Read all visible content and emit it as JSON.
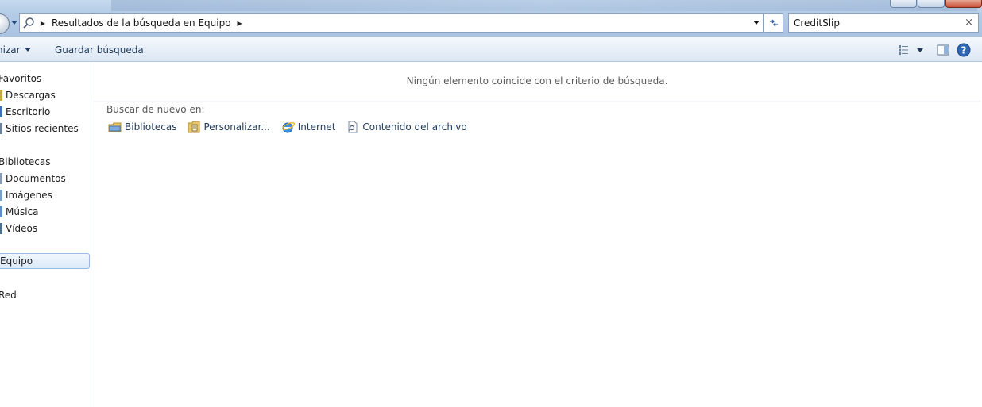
{
  "address": {
    "path_label": "Resultados de la búsqueda en Equipo"
  },
  "search": {
    "value": "CreditSlip",
    "clear_glyph": "×"
  },
  "toolbar": {
    "organize_label": "nizar",
    "save_search_label": "Guardar búsqueda"
  },
  "nav": {
    "favorites": "Favoritos",
    "downloads": "Descargas",
    "desktop": "Escritorio",
    "recent": "Sitios recientes",
    "libraries": "Bibliotecas",
    "documents": "Documentos",
    "images": "Imágenes",
    "music": "Música",
    "videos": "Vídeos",
    "computer": "Equipo",
    "network": "Red"
  },
  "content": {
    "no_match": "Ningún elemento coincide con el criterio de búsqueda.",
    "search_again_label": "Buscar de nuevo en:",
    "search_again_items": [
      "Bibliotecas",
      "Personalizar...",
      "Internet",
      "Contenido del archivo"
    ]
  },
  "icons": {
    "search": "search-icon",
    "refresh": "refresh-icon",
    "views": "views-icon",
    "preview_pane": "preview-pane-icon",
    "help": "help-icon",
    "libraries": "libraries-icon",
    "customize": "customize-icon",
    "internet": "internet-explorer-icon",
    "file_contents": "file-contents-icon"
  },
  "colors": {
    "selection_border": "#9bbbe2",
    "link_text": "#1e395b",
    "glass": "#b3cbe6"
  }
}
